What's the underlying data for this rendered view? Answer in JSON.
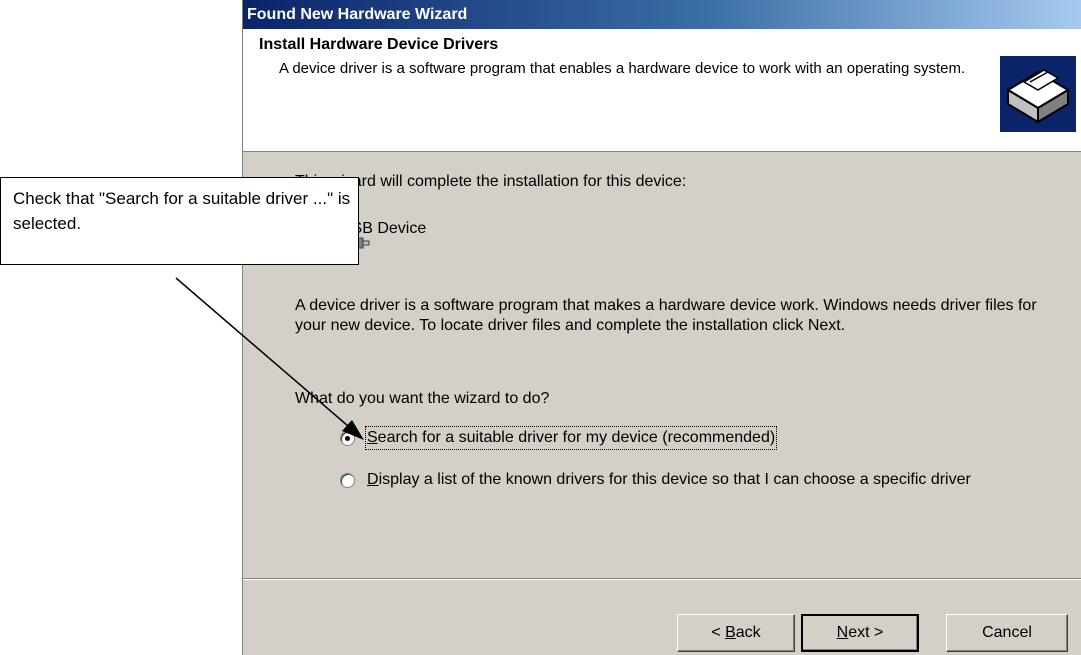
{
  "window": {
    "title": "Found New Hardware Wizard"
  },
  "header": {
    "title": "Install Hardware Device Drivers",
    "subtitle": "A device driver is a software program that enables a hardware device to work with an operating system."
  },
  "body": {
    "intro": "This wizard will complete the installation for this device:",
    "device_name": "USB Device",
    "explanation": "A device driver is a software program that makes a hardware device work. Windows needs driver files for your new device. To locate driver files and complete the installation click Next.",
    "question": "What do you want the wizard to do?",
    "options": [
      {
        "label_key": "S",
        "label_rest": "earch for a suitable driver for my device (recommended)",
        "selected": true
      },
      {
        "label_key": "D",
        "label_rest": "isplay a list of the known drivers for this device so that I can choose a specific driver",
        "selected": false
      }
    ]
  },
  "buttons": {
    "back_prefix": "< ",
    "back_key": "B",
    "back_rest": "ack",
    "next_key": "N",
    "next_rest": "ext >",
    "cancel": "Cancel"
  },
  "callout": {
    "text": "Check that \"Search for a suitable driver ...\" is selected."
  },
  "icons": {
    "header": "hardware-card-icon",
    "device": "usb-device-icon"
  }
}
